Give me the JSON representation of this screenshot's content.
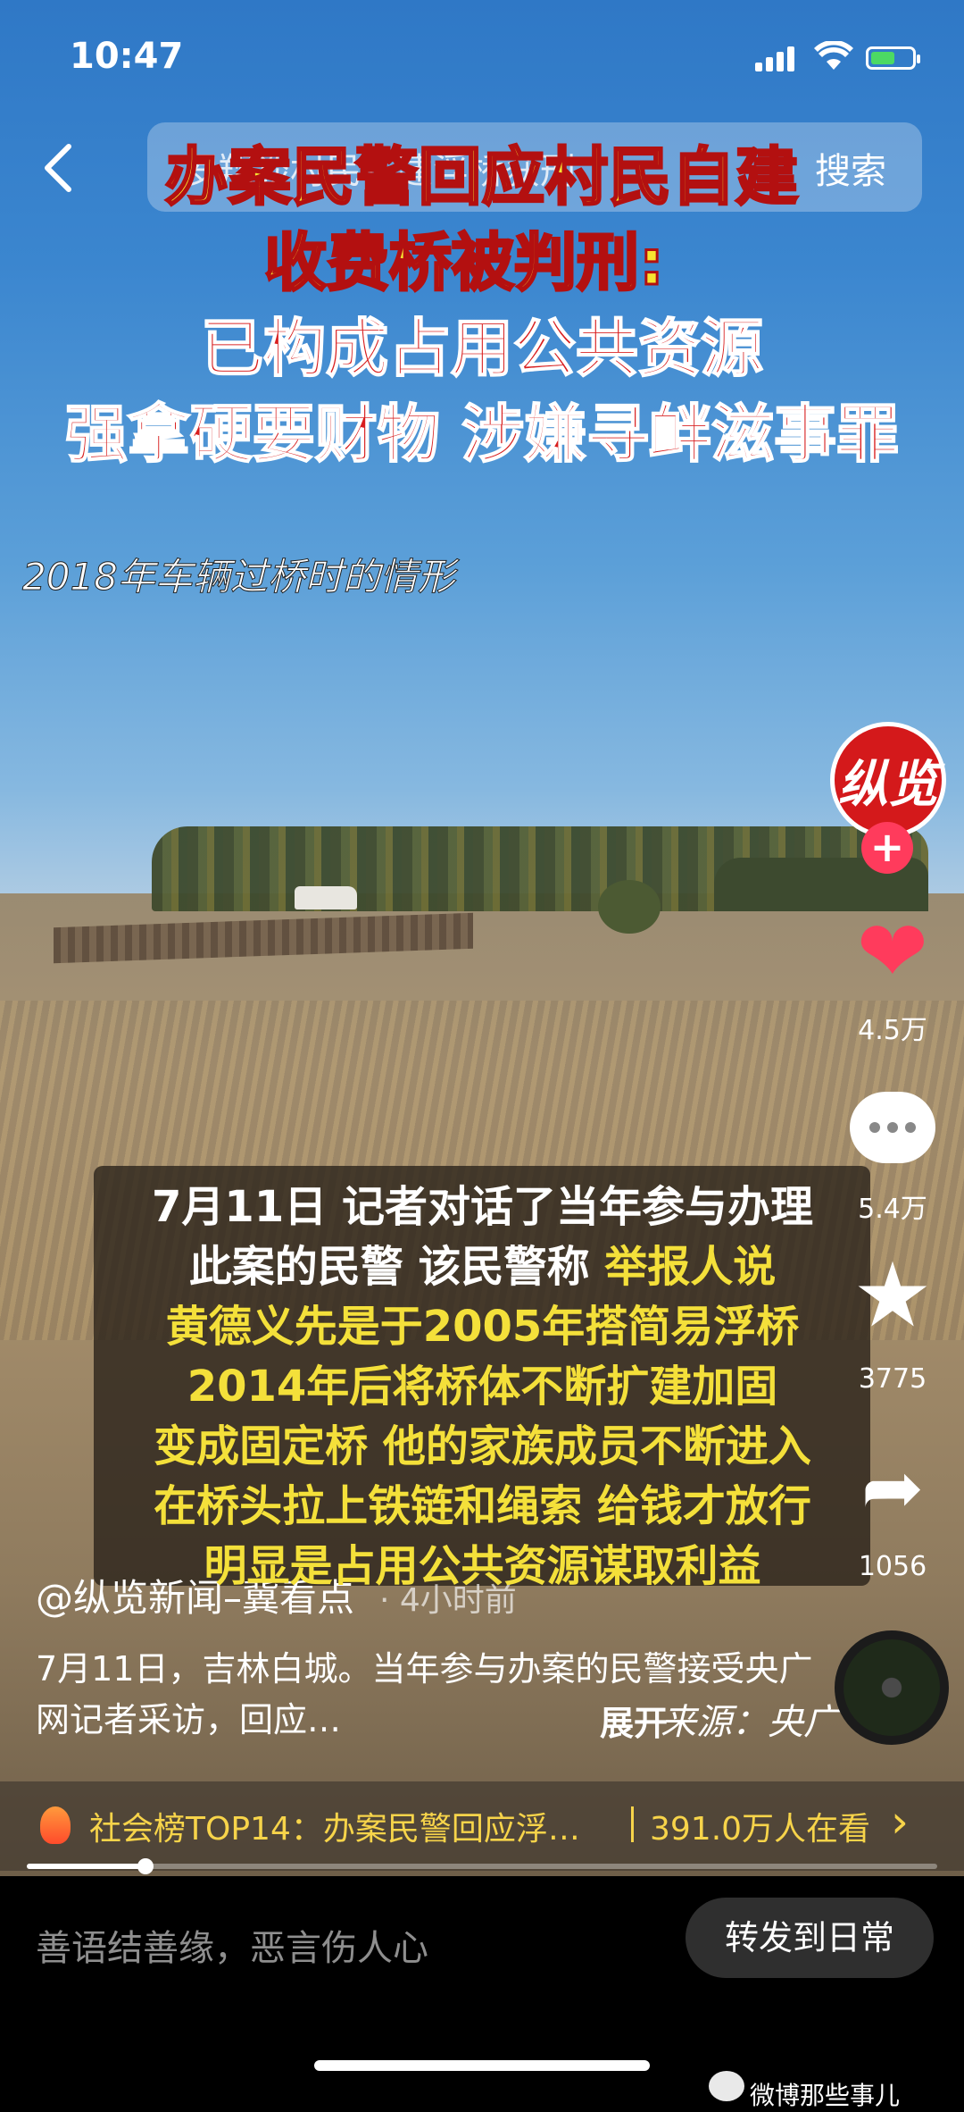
{
  "status_bar": {
    "time": "10:47"
  },
  "search": {
    "query": "罗翔谈村民私建浮桥获刑",
    "button": "搜索"
  },
  "video": {
    "headline": [
      "办案民警回应村民自建",
      "收费桥被判刑:",
      "已构成占用公共资源",
      "强拿硬要财物 涉嫌寻衅滋事罪"
    ],
    "caption": "2018年车辆过桥时的情形",
    "subtitle": {
      "line1": "7月11日 记者对话了当年参与办理",
      "line2_white": "此案的民警 该民警称 ",
      "line2_yellow": "举报人说",
      "line3": "黄德义先是于2005年搭简易浮桥",
      "line4": "2014年后将桥体不断扩建加固",
      "line5": "变成固定桥 他的家族成员不断进入",
      "line6": "在桥头拉上铁链和绳索 给钱才放行",
      "line7": "明显是占用公共资源谋取利益"
    }
  },
  "rail": {
    "avatar_text": "纵览",
    "follow": "+",
    "likes": "4.5万",
    "comments": "5.4万",
    "favorites": "3775",
    "shares": "1056"
  },
  "post": {
    "author": "@纵览新闻–冀看点",
    "time_ago": "· 4小时前",
    "description": "7月11日，吉林白城。当年参与办案的民警接受央广网记者采访，回应…",
    "expand": "展开",
    "source": "来源：央广"
  },
  "hot": {
    "text": "社会榜TOP14：办案民警回应浮…",
    "count": "391.0万人在看",
    "progress": 0.13
  },
  "bottom": {
    "comment_placeholder": "善语结善缘，恶言伤人心",
    "repost": "转发到日常",
    "watermark": "微博那些事儿"
  },
  "colors": {
    "accent_red": "#ff3b5c",
    "hot_yellow": "#f7d44a",
    "headline_yellow": "#f6e531"
  }
}
